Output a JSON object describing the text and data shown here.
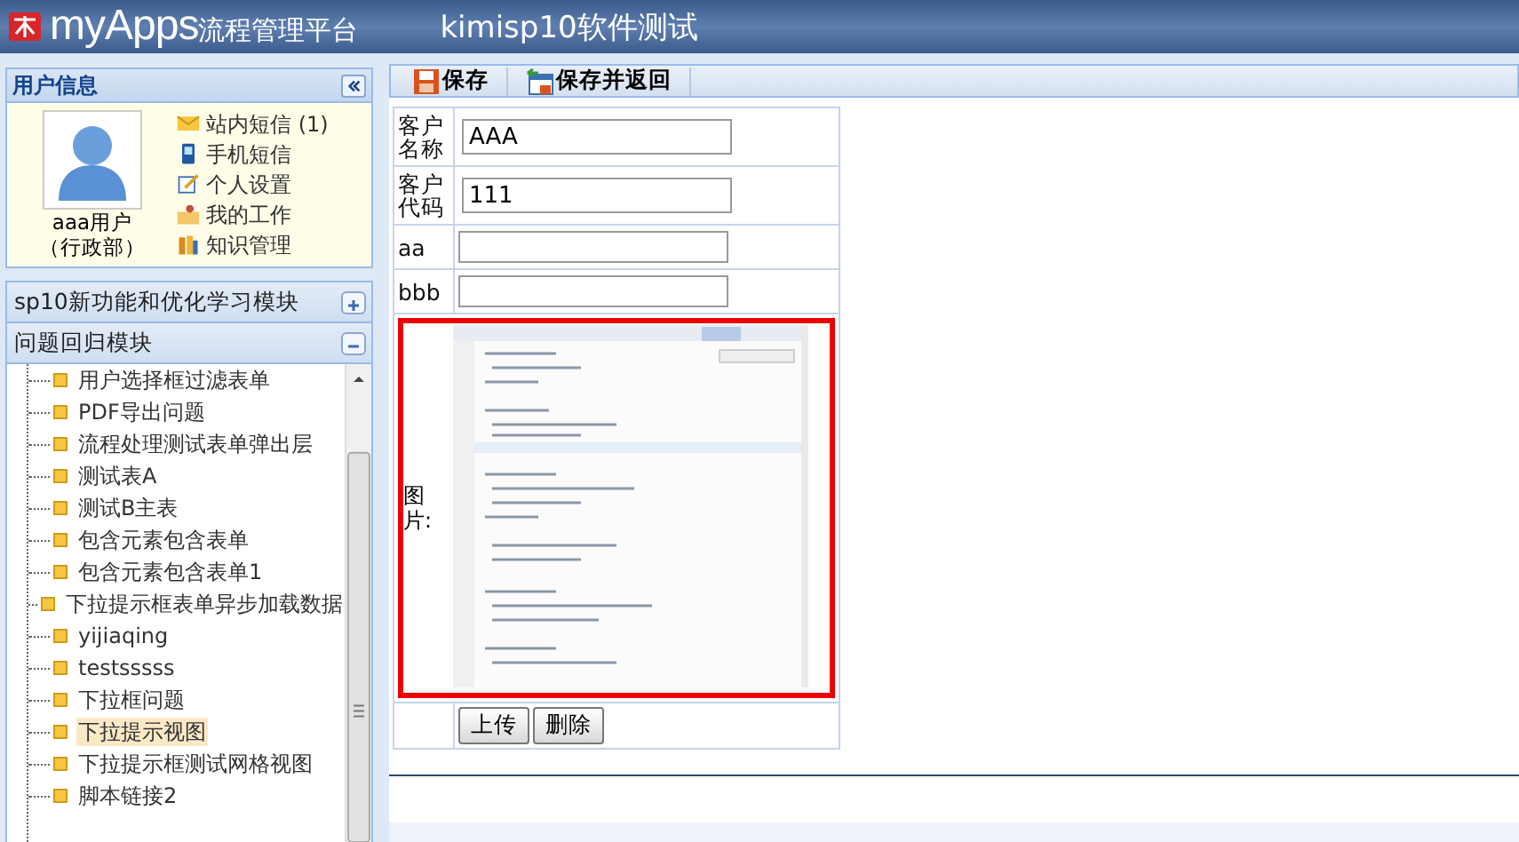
{
  "header": {
    "logo": "myApps",
    "platform": "流程管理平台",
    "app_title": "kimisp10软件测试"
  },
  "user_panel": {
    "title": "用户信息",
    "user_name": "aaa用户",
    "department": "（行政部）",
    "links": [
      {
        "kind": "mail",
        "label": "站内短信 (1)"
      },
      {
        "kind": "phone",
        "label": "手机短信"
      },
      {
        "kind": "edit",
        "label": "个人设置"
      },
      {
        "kind": "work",
        "label": "我的工作"
      },
      {
        "kind": "knowledge",
        "label": "知识管理"
      }
    ]
  },
  "modules": [
    {
      "label": "sp10新功能和优化学习模块",
      "expanded": false
    },
    {
      "label": "问题回归模块",
      "expanded": true
    }
  ],
  "tree_items": [
    {
      "label": "用户选择框过滤表单",
      "selected": false
    },
    {
      "label": "PDF导出问题",
      "selected": false
    },
    {
      "label": "流程处理测试表单弹出层",
      "selected": false
    },
    {
      "label": "测试表A",
      "selected": false
    },
    {
      "label": "测试B主表",
      "selected": false
    },
    {
      "label": "包含元素包含表单",
      "selected": false
    },
    {
      "label": "包含元素包含表单1",
      "selected": false
    },
    {
      "label": "下拉提示框表单异步加载数据",
      "selected": false
    },
    {
      "label": "yijiaqing",
      "selected": false
    },
    {
      "label": "testsssss",
      "selected": false
    },
    {
      "label": "下拉框问题",
      "selected": false
    },
    {
      "label": "下拉提示视图",
      "selected": true
    },
    {
      "label": "下拉提示框测试网格视图",
      "selected": false
    },
    {
      "label": "脚本链接2",
      "selected": false
    }
  ],
  "toolbar": [
    {
      "kind": "save",
      "label": "保存"
    },
    {
      "kind": "save_return",
      "label": "保存并返回"
    }
  ],
  "form": {
    "fields": [
      {
        "label": "客户名称",
        "value": "AAA"
      },
      {
        "label": "客户代码",
        "value": "111"
      },
      {
        "label": "aa"
      },
      {
        "label": "bbb"
      }
    ],
    "image_field": {
      "label": "图片:",
      "buttons": [
        "上传",
        "删除"
      ]
    }
  }
}
